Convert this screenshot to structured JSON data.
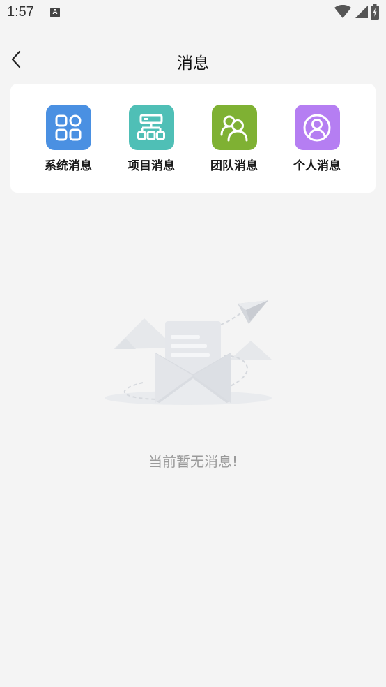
{
  "status_bar": {
    "time": "1:57",
    "app_icon_letter": "A"
  },
  "header": {
    "title": "消息"
  },
  "categories": [
    {
      "label": "系统消息",
      "icon": "grid-apps-icon",
      "color": "#4a90e2"
    },
    {
      "label": "项目消息",
      "icon": "hierarchy-icon",
      "color": "#4fbfb6"
    },
    {
      "label": "团队消息",
      "icon": "team-icon",
      "color": "#7fb133"
    },
    {
      "label": "个人消息",
      "icon": "user-circle-icon",
      "color": "#b57ef2"
    }
  ],
  "empty_state": {
    "message": "当前暂无消息!",
    "icon": "envelope-paper-plane-illustration"
  }
}
